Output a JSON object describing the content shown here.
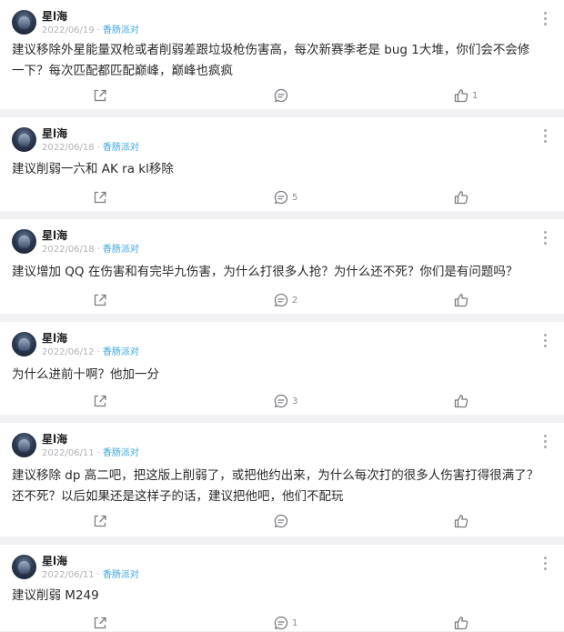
{
  "posts": [
    {
      "username": "星l海",
      "date": "2022/06/19",
      "dot": "·",
      "tag": "香肠派对",
      "lines": [
        "建议移除外星能量双枪或者削弱差跟垃圾枪伤害高，每次新赛季老是 bug 1大堆，你们会不会修",
        "一下？每次匹配都匹配巅峰，巅峰也疯疯"
      ],
      "comments": "",
      "likes": "1"
    },
    {
      "username": "星l海",
      "date": "2022/06/18",
      "dot": "·",
      "tag": "香肠派对",
      "lines": [
        "建议削弱一六和 AK ra kl移除"
      ],
      "comments": "5",
      "likes": ""
    },
    {
      "username": "星l海",
      "date": "2022/06/18",
      "dot": "·",
      "tag": "香肠派对",
      "lines": [
        "建议增加 QQ 在伤害和有完毕九伤害，为什么打很多人抢？为什么还不死？你们是有问题吗？"
      ],
      "comments": "2",
      "likes": ""
    },
    {
      "username": "星l海",
      "date": "2022/06/12",
      "dot": "·",
      "tag": "香肠派对",
      "lines": [
        "为什么进前十啊？他加一分"
      ],
      "comments": "3",
      "likes": ""
    },
    {
      "username": "星l海",
      "date": "2022/06/11",
      "dot": "·",
      "tag": "香肠派对",
      "lines": [
        "建议移除 dp 高二吧，把这版上削弱了，或把他约出来，为什么每次打的很多人伤害打得很满了？",
        "还不死？以后如果还是这样子的话，建议把他吧，他们不配玩"
      ],
      "comments": "",
      "likes": ""
    },
    {
      "username": "星l海",
      "date": "2022/06/11",
      "dot": "·",
      "tag": "香肠派对",
      "lines": [
        "建议削弱 M249"
      ],
      "comments": "1",
      "likes": ""
    }
  ]
}
